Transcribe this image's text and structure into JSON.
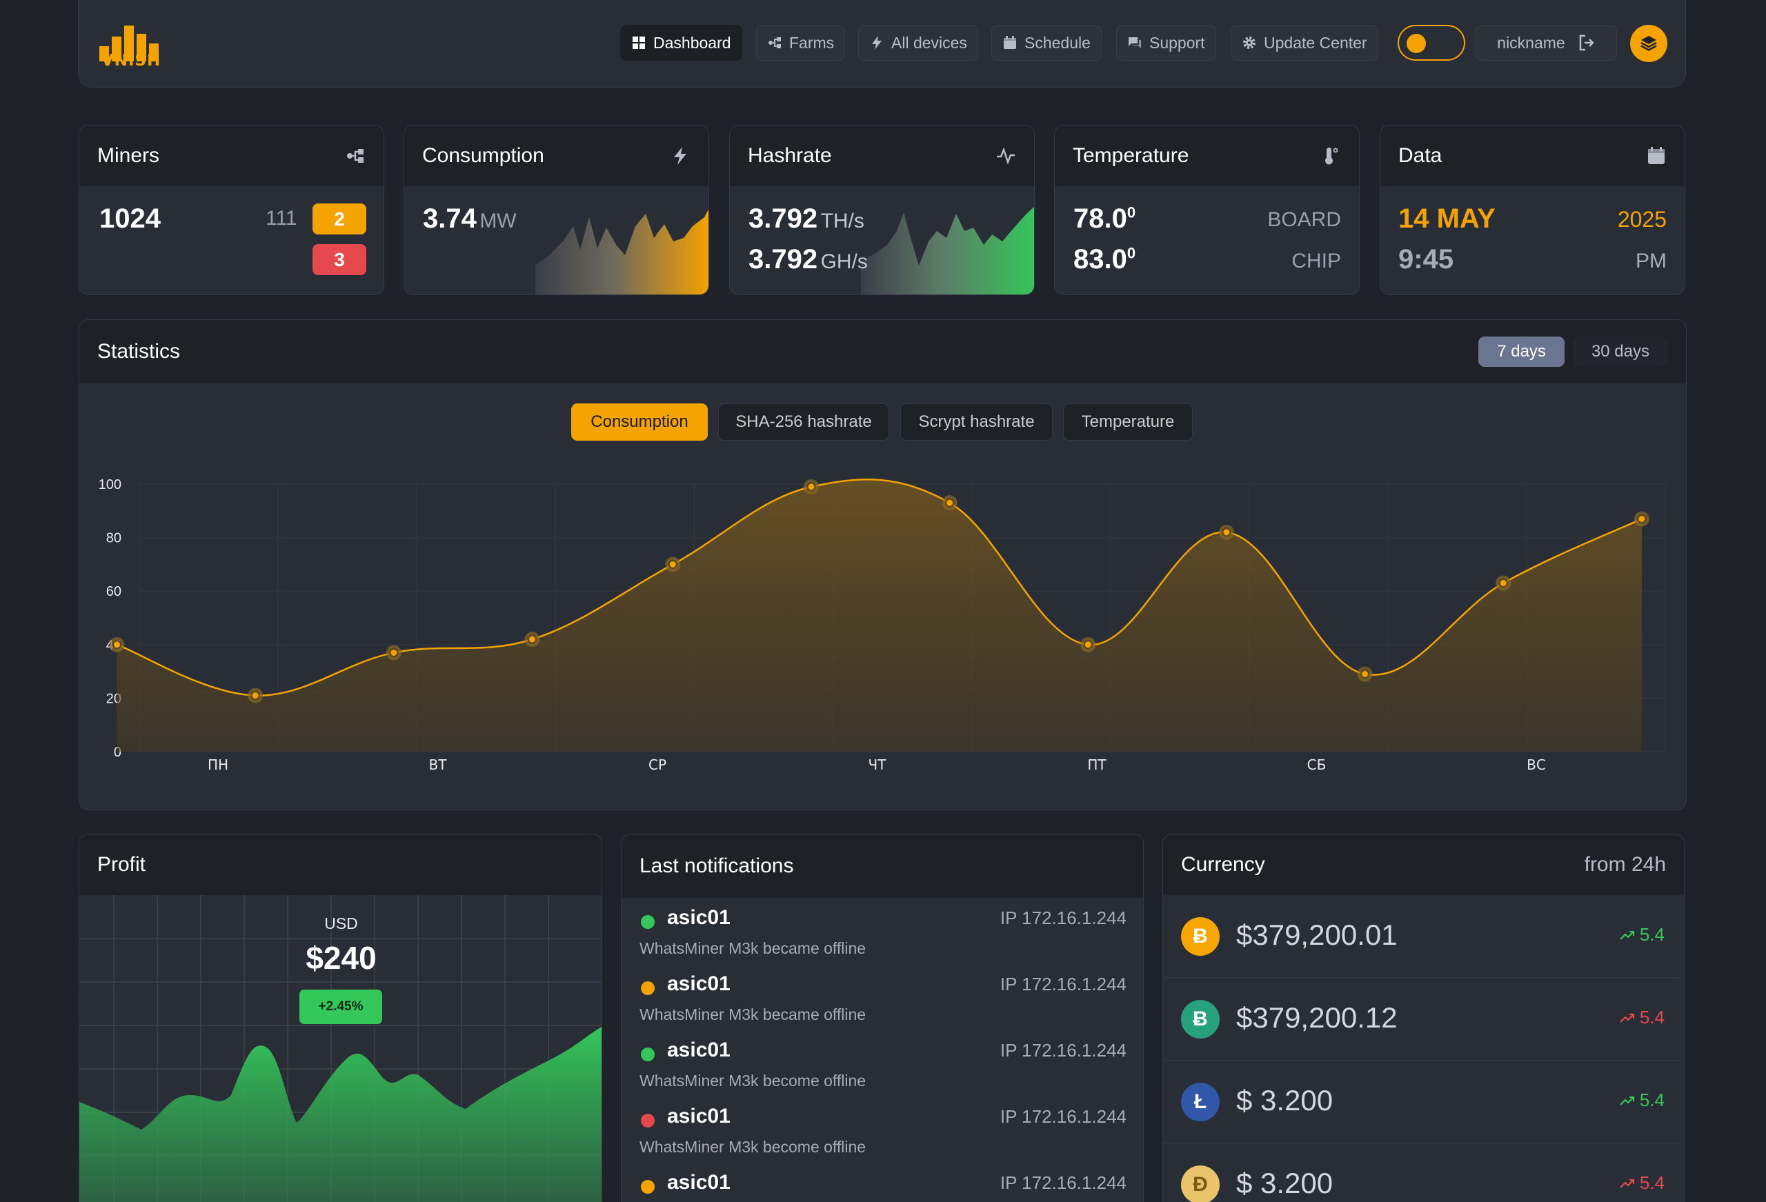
{
  "header": {
    "logo_text": "VNISH",
    "nav": [
      {
        "label": "Dashboard",
        "icon": "grid-icon",
        "active": true
      },
      {
        "label": "Farms",
        "icon": "network-icon",
        "active": false
      },
      {
        "label": "All devices",
        "icon": "bolt-icon",
        "active": false
      },
      {
        "label": "Schedule",
        "icon": "calendar-icon",
        "active": false
      },
      {
        "label": "Support",
        "icon": "chat-icon",
        "active": false
      },
      {
        "label": "Update Center",
        "icon": "gear-icon",
        "active": false
      }
    ],
    "user": "nickname",
    "accent": "#f5a300"
  },
  "cards": {
    "miners": {
      "title": "Miners",
      "total": "1024",
      "online": "111",
      "warning": "2",
      "error": "3"
    },
    "consumption": {
      "title": "Consumption",
      "value": "3.74",
      "unit": "MW"
    },
    "hashrate": {
      "title": "Hashrate",
      "value1": "3.792",
      "unit1": "TH/s",
      "value2": "3.792",
      "unit2": "GH/s"
    },
    "temperature": {
      "title": "Temperature",
      "board": "78.0",
      "board_label": "BOARD",
      "chip": "83.0",
      "chip_label": "CHIP",
      "degree": "0"
    },
    "data": {
      "title": "Data",
      "date": "14 MAY",
      "year": "2025",
      "time": "9:45",
      "ampm": "PM"
    }
  },
  "statistics": {
    "title": "Statistics",
    "ranges": [
      {
        "label": "7 days",
        "active": true
      },
      {
        "label": "30 days",
        "active": false
      }
    ],
    "metrics": [
      {
        "label": "Consumption",
        "active": true
      },
      {
        "label": "SHA-256 hashrate",
        "active": false
      },
      {
        "label": "Scrypt hashrate",
        "active": false
      },
      {
        "label": "Temperature",
        "active": false
      }
    ]
  },
  "chart_data": {
    "type": "area",
    "categories": [
      "ПН",
      "ВТ",
      "СР",
      "ЧТ",
      "ПТ",
      "СБ",
      "ВС"
    ],
    "yticks": [
      "100",
      "80",
      "60",
      "40",
      "20",
      "0"
    ],
    "ylim": [
      0,
      100
    ],
    "x": [
      0,
      0.5,
      1,
      1.5,
      2,
      2.5,
      3,
      3.5,
      4,
      4.5,
      5,
      5.5,
      6
    ],
    "values": [
      40,
      21,
      37,
      42,
      70,
      99,
      93,
      40,
      82,
      29,
      63,
      87
    ],
    "points": [
      [
        -0.46,
        40
      ],
      [
        0.17,
        21
      ],
      [
        0.8,
        37
      ],
      [
        1.43,
        42
      ],
      [
        2.07,
        70
      ],
      [
        2.7,
        99
      ],
      [
        3.33,
        93
      ],
      [
        3.96,
        40
      ],
      [
        4.59,
        82
      ],
      [
        5.22,
        29
      ],
      [
        5.85,
        63
      ],
      [
        6.48,
        87
      ]
    ],
    "grid": true,
    "color": "#f5a300"
  },
  "profit": {
    "title": "Profit",
    "currency": "USD",
    "value": "$240",
    "change": "+2.45%"
  },
  "notifications": {
    "title": "Last notifications",
    "items": [
      {
        "name": "asic01",
        "ip": "IP 172.16.1.244",
        "desc": "WhatsMiner M3k became offline",
        "color": "#34c759"
      },
      {
        "name": "asic01",
        "ip": "IP 172.16.1.244",
        "desc": "WhatsMiner M3k became offline",
        "color": "#f5a300"
      },
      {
        "name": "asic01",
        "ip": "IP 172.16.1.244",
        "desc": "WhatsMiner M3k become offline",
        "color": "#34c759"
      },
      {
        "name": "asic01",
        "ip": "IP 172.16.1.244",
        "desc": "WhatsMiner M3k become offline",
        "color": "#e5484d"
      },
      {
        "name": "asic01",
        "ip": "IP 172.16.1.244",
        "desc": "",
        "color": "#f5a300"
      }
    ]
  },
  "currency": {
    "title": "Currency",
    "period": "from 24h",
    "items": [
      {
        "symbol": "Ƀ",
        "price": "$379,200.01",
        "change": "5.4",
        "coin_color": "#f7a600",
        "trend_color": "#34c759"
      },
      {
        "symbol": "Ƀ",
        "price": "$379,200.12",
        "change": "5.4",
        "coin_color": "#26a17b",
        "trend_color": "#e5484d"
      },
      {
        "symbol": "Ł",
        "price": "$ 3.200",
        "change": "5.4",
        "coin_color": "#3157a8",
        "trend_color": "#34c759"
      },
      {
        "symbol": "Ð",
        "price": "$ 3.200",
        "change": "5.4",
        "coin_color": "#e9c46a",
        "trend_color": "#e5484d"
      }
    ]
  }
}
